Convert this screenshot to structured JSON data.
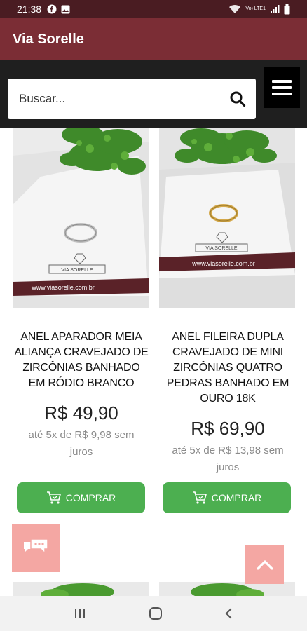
{
  "status": {
    "time": "21:38",
    "net": "Vo) LTE1"
  },
  "app": {
    "title": "Via Sorelle"
  },
  "search": {
    "placeholder": "Buscar..."
  },
  "products": [
    {
      "name": "ANEL APARADOR MEIA ALIANÇA CRAVEJADO DE ZIRCÔNIAS BANHADO EM RÓDIO BRANCO",
      "price": "R$ 49,90",
      "installments": "até 5x de R$ 9,98 sem juros",
      "buy_label": "COMPRAR",
      "card_url": "www.viasorelle.com.br",
      "brand": "VIA SORELLE",
      "ring_color": "#c9c9c9"
    },
    {
      "name": "ANEL FILEIRA DUPLA CRAVEJADO DE MINI ZIRCÔNIAS QUATRO PEDRAS BANHADO EM OURO 18K",
      "price": "R$ 69,90",
      "installments": "até 5x de R$ 13,98 sem juros",
      "buy_label": "COMPRAR",
      "card_url": "www.viasorelle.com.br",
      "brand": "VIA SORELLE",
      "ring_color": "#d4a84a"
    }
  ],
  "colors": {
    "app_bar": "#7b2d35",
    "status_bar": "#4a1c22",
    "buy_button": "#4caf50",
    "fab": "#f4a7a3"
  },
  "icons": [
    "search-icon",
    "menu-icon",
    "cart-icon",
    "chat-icon",
    "chevron-up-icon",
    "nav-recents-icon",
    "nav-home-icon",
    "nav-back-icon"
  ]
}
